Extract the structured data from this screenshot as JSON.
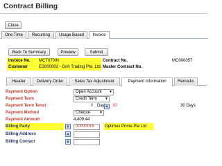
{
  "title": "Contract Billing",
  "close_label": "Close",
  "tabs": [
    {
      "label": "One Time"
    },
    {
      "label": "Recurring"
    },
    {
      "label": "Usage Based"
    },
    {
      "label": "Invoice"
    }
  ],
  "buttons": {
    "back": "Back To Summary",
    "preview": "Preview",
    "submit": "Submit"
  },
  "info": {
    "invoice_no_label": "Invoice No.",
    "invoice_no": "MCT070IN",
    "contract_no_label": "Contract No.",
    "contract_no": "MC000057",
    "customer_label": "Customer",
    "customer": "ES000002 - Goh Trading Pte. Ltd.",
    "master_contract_label": "Master Contract No."
  },
  "subtabs": [
    {
      "label": "Header"
    },
    {
      "label": "Delivery Order"
    },
    {
      "label": "Sales Tax Adjustment"
    },
    {
      "label": "Payment Information"
    },
    {
      "label": "Remarks"
    }
  ],
  "form": {
    "payment_option_label": "Payment Option",
    "payment_option": "Open Account",
    "payment_term_label": "Payment Term",
    "payment_term": "Credit Term",
    "payment_term_tenor_label": "Payment Term Tenor",
    "tenor_zero": "0",
    "tenor_days": "Days",
    "tenor_value": "30",
    "tenor_right": "30 Days",
    "payment_method_label": "Payment Method",
    "payment_method": "Cheque",
    "payment_amount_label": "Payment Amount",
    "payment_amount": "4,409.44",
    "billing_party_label": "Billing Party",
    "billing_party_code": "00000015",
    "billing_party_name": "Optimus Prime Pte Ltd",
    "billing_address_label": "Billing Address",
    "billing_contact_label": "Billing Contact"
  },
  "colors": {
    "highlight": "#ffff33",
    "required_label": "#c0392b"
  }
}
